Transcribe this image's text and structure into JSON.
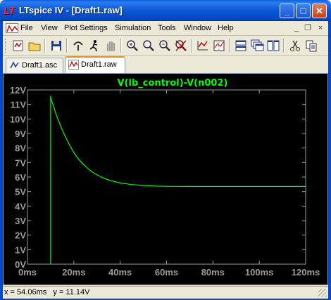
{
  "window": {
    "title": "LTspice IV - [Draft1.raw]",
    "app_icon_glyph": "LT",
    "minimize_glyph": "_",
    "maximize_glyph": "□",
    "close_glyph": "✕"
  },
  "menu": {
    "items": [
      "File",
      "View",
      "Plot Settings",
      "Simulation",
      "Tools",
      "Window",
      "Help"
    ],
    "mdi_min": "_",
    "mdi_restore": "❐",
    "mdi_close": "×"
  },
  "toolbar": {
    "icons": [
      "new-schematic-icon",
      "open-icon",
      "save-icon",
      "control-panel-icon",
      "run-icon",
      "halt-icon",
      "zoom-area-icon",
      "zoom-in-icon",
      "zoom-out-icon",
      "zoom-full-icon",
      "autorange-icon",
      "grid-icon",
      "tile-horizontal-icon",
      "cascade-icon",
      "tile-vertical-icon",
      "cut-icon",
      "copy-icon"
    ]
  },
  "tabs": [
    {
      "label": "Draft1.asc",
      "active": false
    },
    {
      "label": "Draft1.raw",
      "active": true
    }
  ],
  "plot": {
    "trace_label": "V(lb_control)-V(n002)",
    "trace_color": "#00ff00",
    "background": "#000000",
    "axis_color": "#9a9a9a"
  },
  "chart_data": {
    "type": "line",
    "title": "V(lb_control)-V(n002)",
    "xlabel": "",
    "ylabel": "",
    "xlim": [
      0,
      120
    ],
    "ylim": [
      0,
      12
    ],
    "x_unit": "ms",
    "y_unit": "V",
    "x_ticks": [
      "0ms",
      "20ms",
      "40ms",
      "60ms",
      "80ms",
      "100ms",
      "120ms"
    ],
    "y_ticks": [
      "0V",
      "1V",
      "2V",
      "3V",
      "4V",
      "5V",
      "6V",
      "7V",
      "8V",
      "9V",
      "10V",
      "11V",
      "12V"
    ],
    "grid": false,
    "series": [
      {
        "name": "V(lb_control)-V(n002)",
        "x": [
          10,
          10,
          10.3,
          11,
          12,
          13,
          14,
          15,
          16,
          18,
          20,
          22,
          24,
          26,
          28,
          30,
          32,
          35,
          38,
          40,
          45,
          50,
          55,
          60,
          70,
          80,
          90,
          100,
          110,
          120
        ],
        "y": [
          0,
          11.6,
          11.3,
          11.0,
          10.5,
          10.05,
          9.65,
          9.25,
          8.9,
          8.25,
          7.7,
          7.25,
          6.9,
          6.6,
          6.35,
          6.15,
          6.0,
          5.8,
          5.67,
          5.6,
          5.48,
          5.42,
          5.38,
          5.36,
          5.35,
          5.35,
          5.35,
          5.35,
          5.35,
          5.35
        ]
      }
    ]
  },
  "status": {
    "cursor_readout": "x = 54.06ms   y = 11.14V"
  }
}
